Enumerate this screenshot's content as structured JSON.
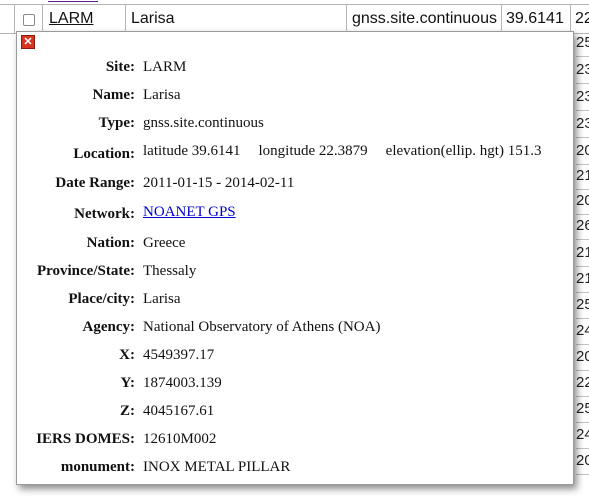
{
  "table_row": {
    "code": "LARM",
    "name": "Larisa",
    "type": "gnss.site.continuous",
    "latitude": "39.6141",
    "right_edge": "22"
  },
  "right_column_partial": [
    "25",
    "23",
    "23",
    "23",
    "20",
    "21",
    "20.",
    "26",
    "21",
    "21",
    "25",
    "24",
    "20",
    "22",
    "25",
    "24",
    "20"
  ],
  "popup": {
    "close_icon": "close-icon",
    "fields": [
      {
        "label": "Site:",
        "value": "LARM"
      },
      {
        "label": "Name:",
        "value": "Larisa"
      },
      {
        "label": "Type:",
        "value": "gnss.site.continuous"
      },
      {
        "label": "Location:",
        "latitude": "latitude 39.6141",
        "longitude": "longitude 22.3879",
        "elevation": "elevation(ellip. hgt) 151.3"
      },
      {
        "label": "Date Range:",
        "value": "2011-01-15 - 2014-02-11"
      },
      {
        "label": "Network:",
        "value": "NOANET GPS"
      },
      {
        "label": "Nation:",
        "value": "Greece"
      },
      {
        "label": "Province/State:",
        "value": "Thessaly"
      },
      {
        "label": "Place/city:",
        "value": "Larisa"
      },
      {
        "label": "Agency:",
        "value": "National Observatory of Athens (NOA)"
      },
      {
        "label": "X:",
        "value": "4549397.17"
      },
      {
        "label": "Y:",
        "value": "1874003.139"
      },
      {
        "label": "Z:",
        "value": "4045167.61"
      },
      {
        "label": "IERS DOMES:",
        "value": "12610M002"
      },
      {
        "label": "monument:",
        "value": "INOX METAL PILLAR"
      }
    ]
  },
  "colors": {
    "visited_link": "#551a8b",
    "link": "#0000cc",
    "close": "#d9341f"
  }
}
